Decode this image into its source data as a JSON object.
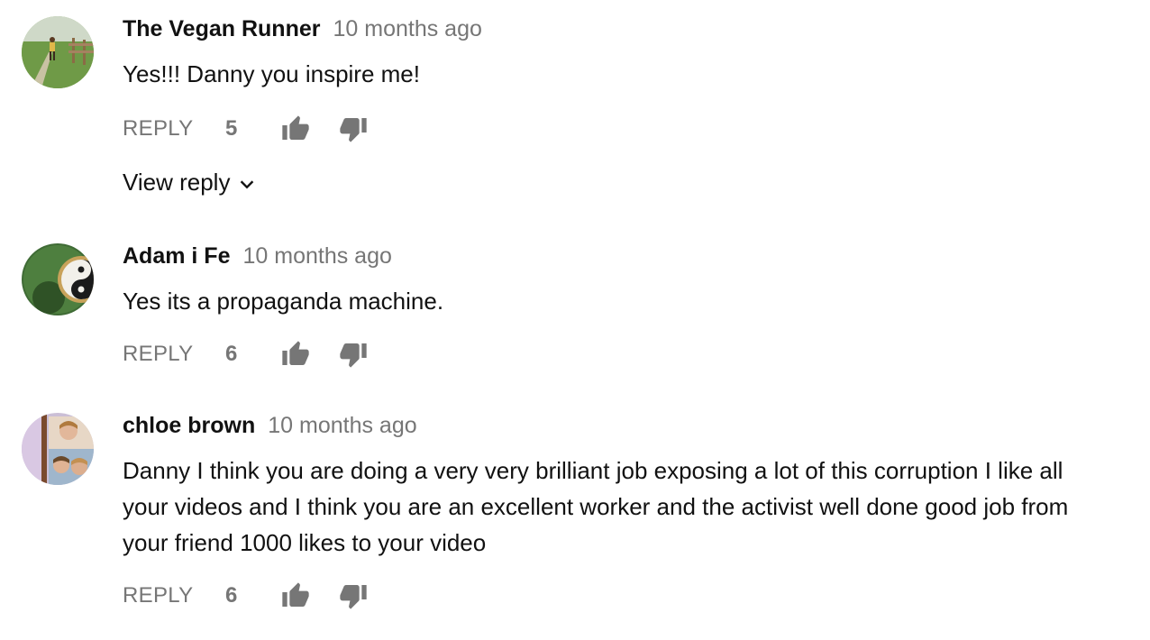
{
  "comments": [
    {
      "author": "The Vegan Runner",
      "time": "10 months ago",
      "text": "Yes!!! Danny you inspire me!",
      "reply_label": "REPLY",
      "likes": "5",
      "view_reply_label": "View reply",
      "avatar_icon": "runner-photo-avatar"
    },
    {
      "author": "Adam i Fe",
      "time": "10 months ago",
      "text": "Yes its a propaganda machine.",
      "reply_label": "REPLY",
      "likes": "6",
      "avatar_icon": "yin-yang-avatar"
    },
    {
      "author": "chloe brown",
      "time": "10 months ago",
      "text": "Danny I think you are doing a very very brilliant job exposing a lot of this corruption I like all your videos and I think you are an excellent worker and the activist well done good job from your friend 1000 likes to your video",
      "reply_label": "REPLY",
      "likes": "6",
      "avatar_icon": "photo-collage-avatar"
    }
  ],
  "colors": {
    "text": "#111111",
    "meta": "#767676"
  }
}
